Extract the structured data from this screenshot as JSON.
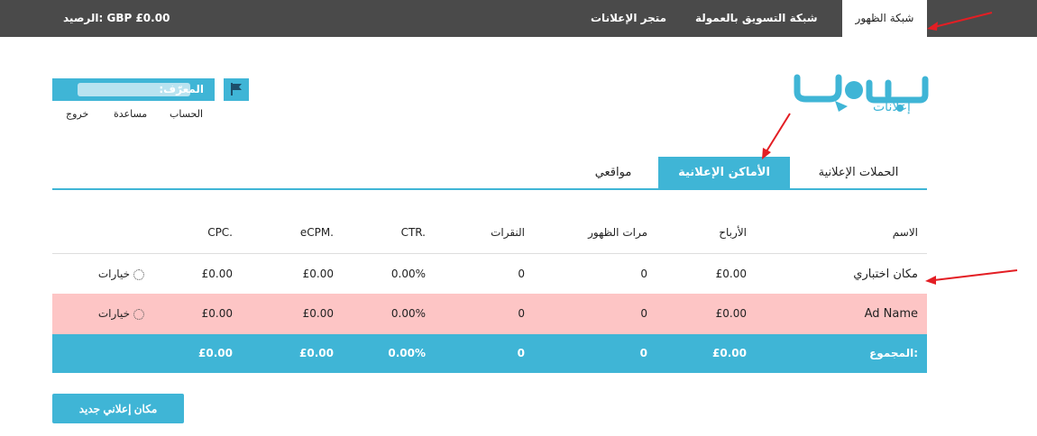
{
  "topnav": {
    "items": [
      "شبكة الظهور",
      "شبكة التسويق بالعمولة",
      "متجر الإعلانات"
    ],
    "balance": "الرصيد: GBP £0.00"
  },
  "user": {
    "id_label": "المعرّف:",
    "links": [
      "الحساب",
      "مساعدة",
      "خروج"
    ]
  },
  "logo": {
    "text": "إعلانات"
  },
  "tabs": [
    "الحملات الإعلانية",
    "الأماكن الإعلانية",
    "مواقعي"
  ],
  "table": {
    "columns": [
      "الاسم",
      "الأرباح",
      "مرات الظهور",
      "النقرات",
      "CTR.",
      "eCPM.",
      "CPC."
    ],
    "rows": [
      {
        "name": "مكان اختباري",
        "earnings": "£0.00",
        "impressions": "0",
        "clicks": "0",
        "ctr": "0.00%",
        "ecpm": "£0.00",
        "cpc": "£0.00",
        "options": "خيارات"
      },
      {
        "name": "Ad Name",
        "earnings": "£0.00",
        "impressions": "0",
        "clicks": "0",
        "ctr": "0.00%",
        "ecpm": "£0.00",
        "cpc": "£0.00",
        "options": "خيارات"
      }
    ],
    "total": {
      "label": "المجموع:",
      "earnings": "£0.00",
      "impressions": "0",
      "clicks": "0",
      "ctr": "0.00%",
      "ecpm": "£0.00",
      "cpc": "£0.00"
    }
  },
  "new_button": "مكان إعلاني جديد",
  "colors": {
    "accent": "#3fb5d6",
    "topbar": "#4a4a4a",
    "highlight_row": "#fdc5c5",
    "arrow": "#e31e24"
  },
  "icons": [
    "flag-icon",
    "gear-icon"
  ]
}
